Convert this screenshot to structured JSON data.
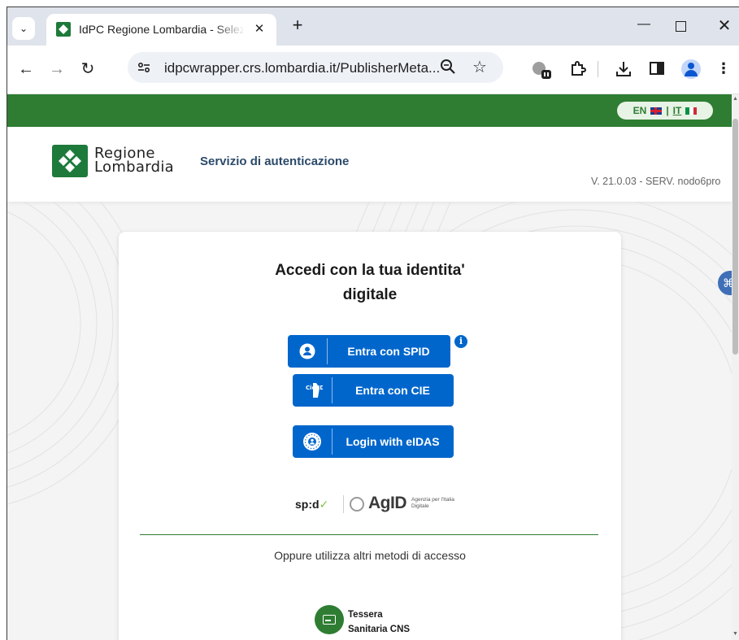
{
  "browser": {
    "tab": {
      "title": "IdPC Regione Lombardia - Selezi",
      "close_glyph": "✕"
    },
    "new_tab_glyph": "+",
    "url": "idpcwrapper.crs.lombardia.it/PublisherMeta...",
    "window_controls": {
      "minimize": "—",
      "close": "✕"
    }
  },
  "page": {
    "language": {
      "en": "EN",
      "separator": "|",
      "it": "IT"
    },
    "logo": {
      "line1": "Regione",
      "line2": "Lombardia"
    },
    "service_title": "Servizio di autenticazione",
    "version": "V. 21.0.03 - SERV. nodo6pro",
    "login": {
      "title_line1": "Accedi con la tua identita'",
      "title_line2": "digitale",
      "buttons": {
        "spid": "Entra con SPID",
        "cie": "Entra con CIE",
        "eidas": "Login with eIDAS"
      },
      "info_glyph": "i",
      "cie_icon_text": "Cie ID"
    },
    "partner_logos": {
      "spid": "sp:d",
      "agid": "AgID",
      "agid_subtitle": "Agenzia per l'Italia Digitale"
    },
    "alternative_text": "Oppure utilizza altri metodi di accesso",
    "cns": {
      "line1": "Tessera",
      "line2": "Sanitaria CNS"
    }
  },
  "colors": {
    "brand_green": "#2e7d32",
    "button_blue": "#0066cc",
    "header_text": "#2c4a6b"
  }
}
